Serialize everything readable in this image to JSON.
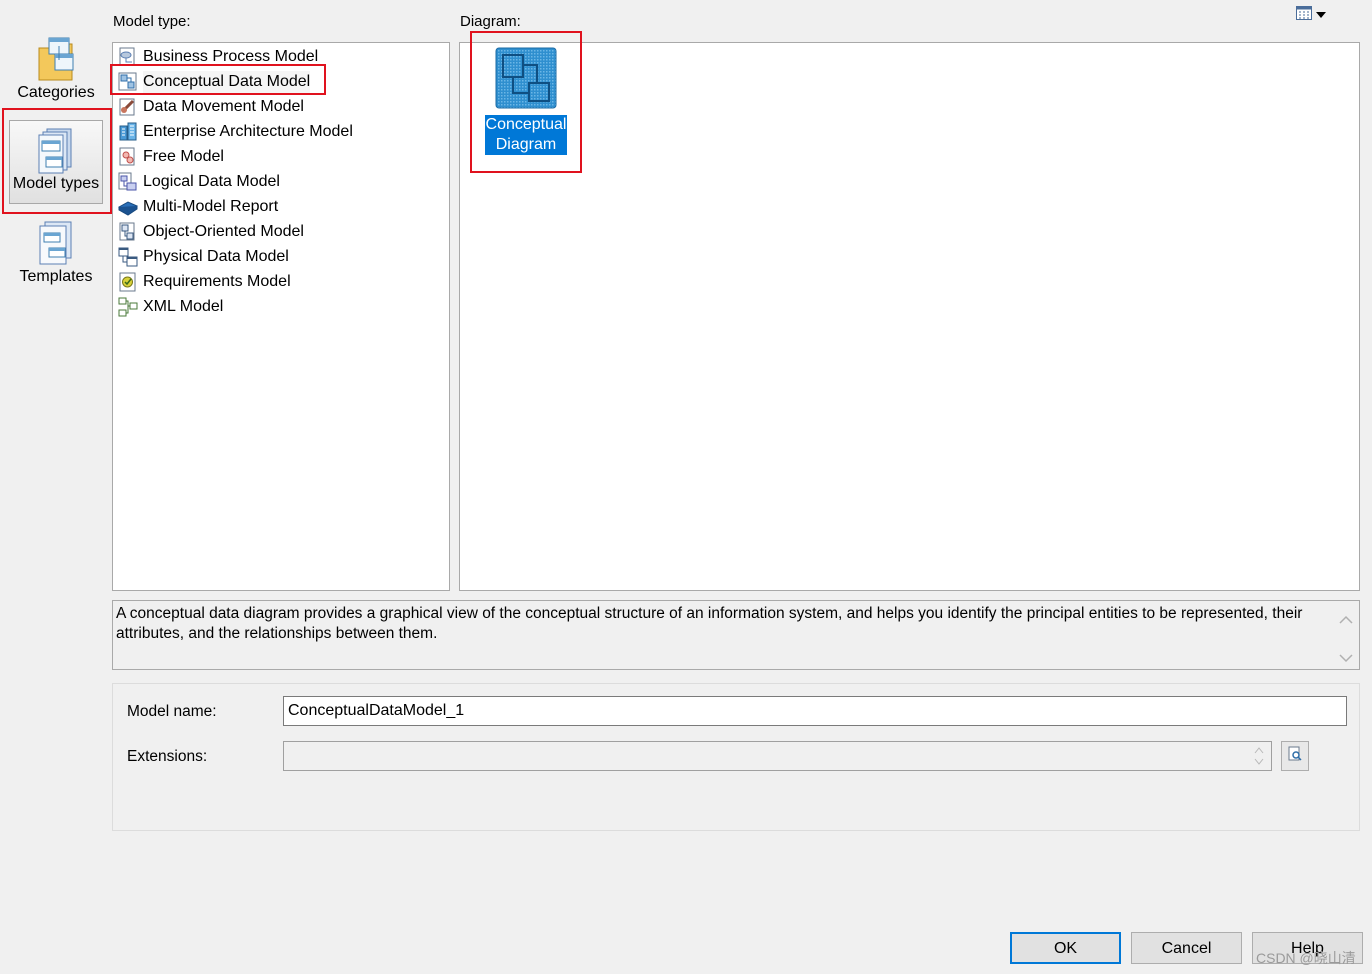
{
  "nav": {
    "items": [
      {
        "label": "Categories",
        "icon": "folder-windows-icon"
      },
      {
        "label": "Model types",
        "icon": "stacked-windows-icon",
        "selected": true
      },
      {
        "label": "Templates",
        "icon": "template-pages-icon"
      }
    ]
  },
  "view_toggle": {
    "icon": "list-view-icon"
  },
  "model_type": {
    "label": "Model type:",
    "selected": "Conceptual Data Model",
    "items": [
      {
        "label": "Business Process Model",
        "icon": "business-process-model-icon"
      },
      {
        "label": "Conceptual Data Model",
        "icon": "conceptual-data-model-icon"
      },
      {
        "label": "Data Movement Model",
        "icon": "data-movement-model-icon"
      },
      {
        "label": "Enterprise Architecture Model",
        "icon": "enterprise-architecture-model-icon"
      },
      {
        "label": "Free Model",
        "icon": "free-model-icon"
      },
      {
        "label": "Logical Data Model",
        "icon": "logical-data-model-icon"
      },
      {
        "label": "Multi-Model Report",
        "icon": "multi-model-report-icon"
      },
      {
        "label": "Object-Oriented Model",
        "icon": "object-oriented-model-icon"
      },
      {
        "label": "Physical Data Model",
        "icon": "physical-data-model-icon"
      },
      {
        "label": "Requirements Model",
        "icon": "requirements-model-icon"
      },
      {
        "label": "XML Model",
        "icon": "xml-model-icon"
      }
    ]
  },
  "diagram": {
    "label": "Diagram:",
    "items": [
      {
        "label_line1": "Conceptual",
        "label_line2": "Diagram",
        "icon": "conceptual-diagram-icon",
        "selected": true
      }
    ]
  },
  "description": "A conceptual data diagram provides a graphical view of the conceptual structure of an information system, and helps you identify the principal entities to be represented, their attributes, and the relationships between them.",
  "form": {
    "model_name_label": "Model name:",
    "model_name_value": "ConceptualDataModel_1",
    "extensions_label": "Extensions:",
    "extensions_value": ""
  },
  "buttons": {
    "ok": "OK",
    "cancel": "Cancel",
    "help": "Help"
  },
  "watermark": "CSDN @晓山清",
  "colors": {
    "highlight_frame": "#e0121e",
    "selection_blue": "#0078d7",
    "dialog_bg": "#f0f0f0"
  }
}
